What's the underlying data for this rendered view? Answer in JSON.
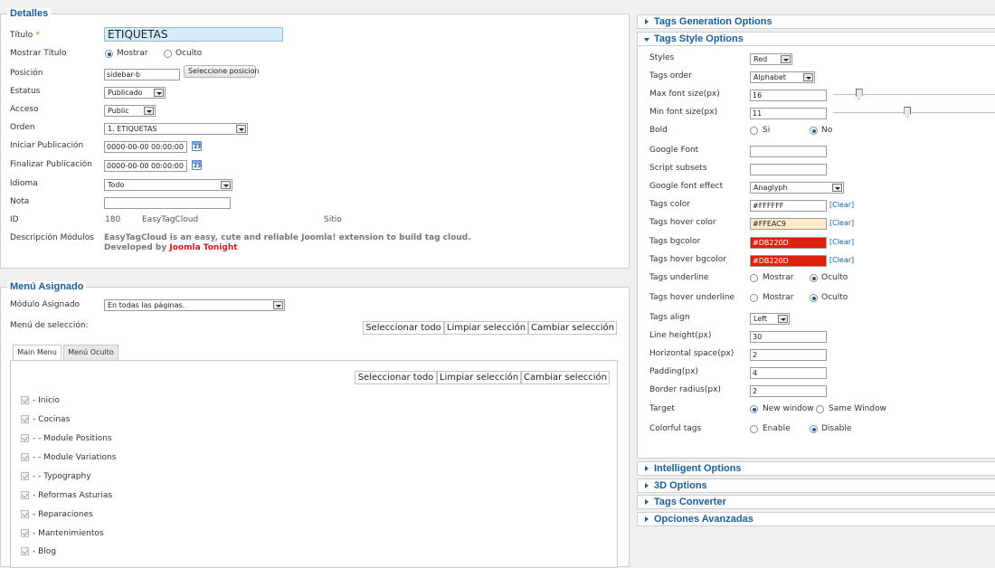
{
  "detalles": {
    "legend": "Detalles",
    "titulo_label": "Título",
    "titulo_required": "*",
    "titulo_value": "ETIQUETAS",
    "mostrar_titulo_label": "Mostrar Título",
    "mostrar_label": "Mostrar",
    "oculto_label": "Oculto",
    "posicion_label": "Posición",
    "posicion_value": "sidebar-b",
    "seleccione_posicion": "Seleccione posicion",
    "estatus_label": "Estatus",
    "estatus_value": "Publicado",
    "acceso_label": "Acceso",
    "acceso_value": "Public",
    "orden_label": "Orden",
    "orden_value": "1. ETIQUETAS",
    "iniciar_label": "Iniciar Publicación",
    "iniciar_value": "0000-00-00 00:00:00",
    "finalizar_label": "Finalizar Publicación",
    "finalizar_value": "0000-00-00 00:00:00",
    "idioma_label": "Idioma",
    "idioma_value": "Todo",
    "nota_label": "Nota",
    "nota_value": "",
    "id_label": "ID",
    "id_value": "180",
    "module_type": "EasyTagCloud",
    "client": "Sitio",
    "descripcion_label": "Descripción Módulos",
    "descripcion_line1": "EasyTagCloud is an easy, cute and reliable Joomla! extension to build tag cloud.",
    "descripcion_line2_prefix": "Developed by",
    "descripcion_author": "Joomla Tonight"
  },
  "menu": {
    "legend": "Menú Asignado",
    "modulo_asignado_label": "Módulo Asignado",
    "modulo_asignado_value": "En todas las páginas.",
    "menu_seleccion_label": "Menú de selección:",
    "select_all": "Seleccionar todo",
    "clear_selection": "Limpiar selección",
    "toggle_selection": "Cambiar selección",
    "tabs": [
      "Main Menu",
      "Menú Oculto"
    ],
    "items": [
      "- Inicio",
      "- Cocinas",
      "- - Module Positions",
      "- - Module Variations",
      "- - Typography",
      "- Reformas Asturias",
      "- Reparaciones",
      "- Mantenimientos",
      "- Blog"
    ]
  },
  "right": {
    "sections": {
      "tags_generation": "Tags Generation Options",
      "tags_style": "Tags Style Options",
      "intelligent": "Intelligent Options",
      "three_d": "3D Options",
      "tags_converter": "Tags Converter",
      "advanced": "Opciones Avanzadas"
    },
    "fields": {
      "styles_label": "Styles",
      "styles_value": "Red",
      "order_label": "Tags order",
      "order_value": "Alphabet",
      "max_font_label": "Max font size(px)",
      "max_font_value": "16",
      "min_font_label": "Min font size(px)",
      "min_font_value": "11",
      "bold_label": "Bold",
      "bold_yes": "Si",
      "bold_no": "No",
      "google_font_label": "Google Font",
      "google_font_value": "",
      "script_subsets_label": "Script subsets",
      "script_subsets_value": "",
      "font_effect_label": "Google font effect",
      "font_effect_value": "Anaglyph",
      "color_label": "Tags color",
      "color_value": "#FFFFFF",
      "hover_color_label": "Tags hover color",
      "hover_color_value": "#FFEAC9",
      "bgcolor_label": "Tags bgcolor",
      "bgcolor_value": "#DB220D",
      "hover_bgcolor_label": "Tags hover bgcolor",
      "hover_bgcolor_value": "#DB220D",
      "clear": "[Clear]",
      "underline_label": "Tags underline",
      "hover_underline_label": "Tags hover underline",
      "mostrar": "Mostrar",
      "oculto": "Oculto",
      "align_label": "Tags align",
      "align_value": "Left",
      "line_height_label": "Line height(px)",
      "line_height_value": "30",
      "hspace_label": "Horizontal space(px)",
      "hspace_value": "2",
      "padding_label": "Padding(px)",
      "padding_value": "4",
      "radius_label": "Border radius(px)",
      "radius_value": "2",
      "target_label": "Target",
      "target_new": "New window",
      "target_same": "Same Window",
      "colorful_label": "Colorful tags",
      "colorful_enable": "Enable",
      "colorful_disable": "Disable"
    },
    "sliders": {
      "max_font_level": 0.16,
      "min_font_level": 0.46
    },
    "colors": {
      "accent": "#1a5d98",
      "bg_swatch": "#DB220D",
      "hover_swatch": "#FFEAC9"
    }
  }
}
